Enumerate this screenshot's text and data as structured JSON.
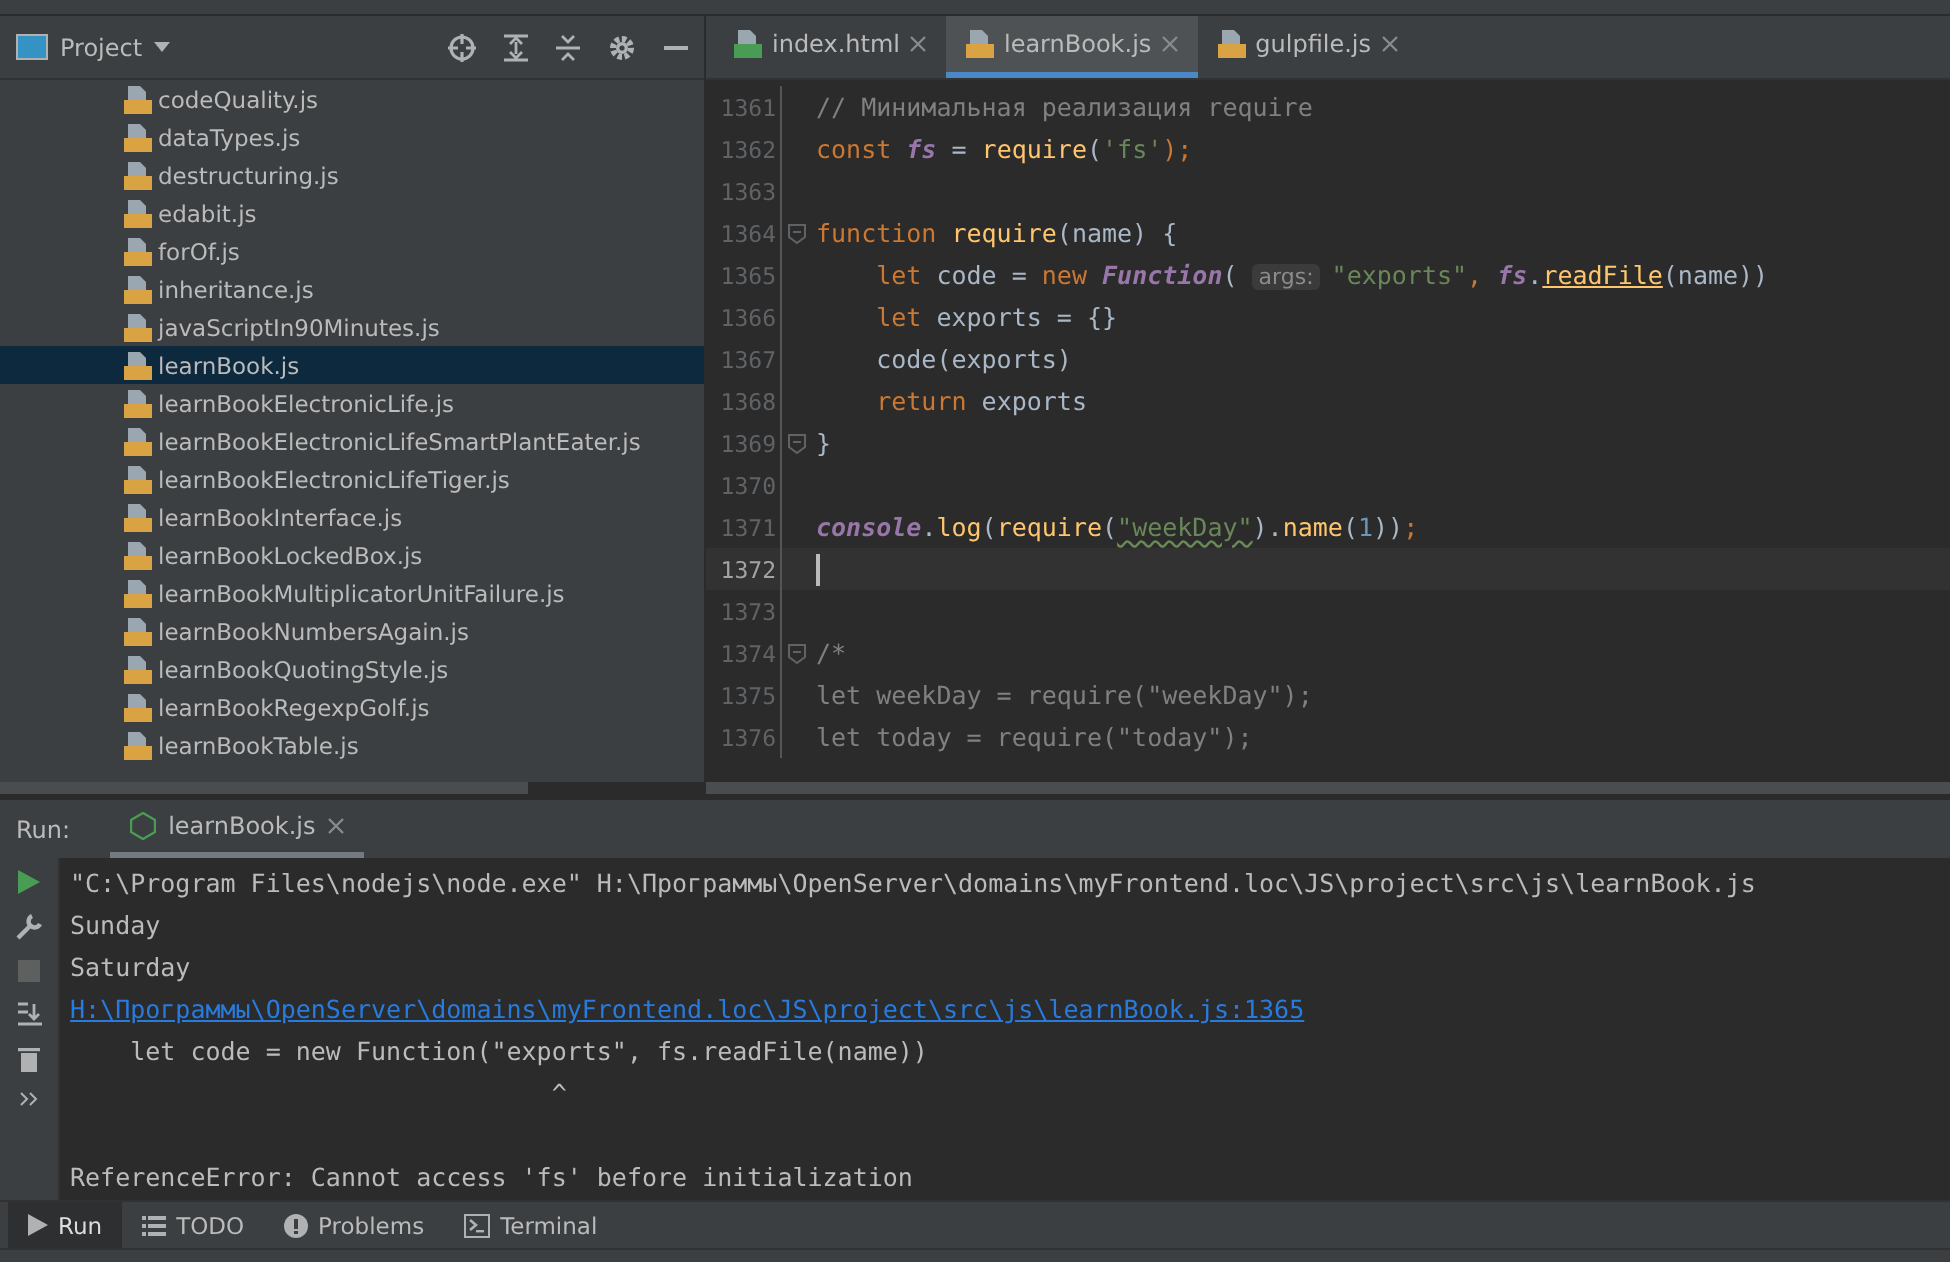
{
  "project_panel": {
    "title": "Project",
    "files": [
      {
        "name": "codeQuality.js",
        "selected": false
      },
      {
        "name": "dataTypes.js",
        "selected": false
      },
      {
        "name": "destructuring.js",
        "selected": false
      },
      {
        "name": "edabit.js",
        "selected": false
      },
      {
        "name": "forOf.js",
        "selected": false
      },
      {
        "name": "inheritance.js",
        "selected": false
      },
      {
        "name": "javaScriptIn90Minutes.js",
        "selected": false
      },
      {
        "name": "learnBook.js",
        "selected": true
      },
      {
        "name": "learnBookElectronicLife.js",
        "selected": false
      },
      {
        "name": "learnBookElectronicLifeSmartPlantEater.js",
        "selected": false
      },
      {
        "name": "learnBookElectronicLifeTiger.js",
        "selected": false
      },
      {
        "name": "learnBookInterface.js",
        "selected": false
      },
      {
        "name": "learnBookLockedBox.js",
        "selected": false
      },
      {
        "name": "learnBookMultiplicatorUnitFailure.js",
        "selected": false
      },
      {
        "name": "learnBookNumbersAgain.js",
        "selected": false
      },
      {
        "name": "learnBookQuotingStyle.js",
        "selected": false
      },
      {
        "name": "learnBookRegexpGolf.js",
        "selected": false
      },
      {
        "name": "learnBookTable.js",
        "selected": false
      }
    ]
  },
  "editor_tabs": [
    {
      "label": "index.html",
      "kind": "html",
      "selected": false
    },
    {
      "label": "learnBook.js",
      "kind": "js",
      "selected": true
    },
    {
      "label": "gulpfile.js",
      "kind": "js",
      "selected": false
    }
  ],
  "code_lines": [
    {
      "number": "1361",
      "current": false,
      "fold": false,
      "tokens": [
        {
          "t": "// Минимальная реализация require",
          "kind": "comment"
        }
      ]
    },
    {
      "number": "1362",
      "current": false,
      "fold": false,
      "tokens": [
        {
          "t": "const ",
          "kind": "keyword"
        },
        {
          "t": "fs",
          "kind": "global"
        },
        {
          "t": " = ",
          "kind": "plain"
        },
        {
          "t": "require",
          "kind": "fn"
        },
        {
          "t": "(",
          "kind": "plain"
        },
        {
          "t": "'fs'",
          "kind": "string"
        },
        {
          "t": ");",
          "kind": "keyword"
        }
      ]
    },
    {
      "number": "1363",
      "current": false,
      "fold": false
    },
    {
      "number": "1364",
      "current": false,
      "fold": true,
      "tokens": [
        {
          "t": "function ",
          "kind": "keyword"
        },
        {
          "t": "require",
          "kind": "fn"
        },
        {
          "t": "(name) {",
          "kind": "plain"
        }
      ]
    },
    {
      "number": "1365",
      "current": false,
      "fold": false,
      "tokens": [
        {
          "t": "    let ",
          "kind": "keyword"
        },
        {
          "t": "code = ",
          "kind": "plain"
        },
        {
          "t": "new ",
          "kind": "keyword"
        },
        {
          "t": "Function",
          "kind": "global"
        },
        {
          "t": "( ",
          "kind": "plain"
        },
        {
          "t": "args:",
          "kind": "hint"
        },
        {
          "t": "\"exports\"",
          "kind": "string"
        },
        {
          "t": ", ",
          "kind": "keyword"
        },
        {
          "t": "fs",
          "kind": "global"
        },
        {
          "t": ".",
          "kind": "plain"
        },
        {
          "t": "readFile",
          "kind": "fnlink"
        },
        {
          "t": "(name))",
          "kind": "plain"
        }
      ]
    },
    {
      "number": "1366",
      "current": false,
      "fold": false,
      "tokens": [
        {
          "t": "    let ",
          "kind": "keyword"
        },
        {
          "t": "exports = {}",
          "kind": "plain"
        }
      ]
    },
    {
      "number": "1367",
      "current": false,
      "fold": false,
      "tokens": [
        {
          "t": "    code(exports)",
          "kind": "plain"
        }
      ]
    },
    {
      "number": "1368",
      "current": false,
      "fold": false,
      "tokens": [
        {
          "t": "    return ",
          "kind": "keyword"
        },
        {
          "t": "exports",
          "kind": "plain"
        }
      ]
    },
    {
      "number": "1369",
      "current": false,
      "fold": true,
      "tokens": [
        {
          "t": "}",
          "kind": "plain"
        }
      ]
    },
    {
      "number": "1370",
      "current": false,
      "fold": false
    },
    {
      "number": "1371",
      "current": false,
      "fold": false,
      "tokens": [
        {
          "t": "console",
          "kind": "global"
        },
        {
          "t": ".",
          "kind": "plain"
        },
        {
          "t": "log",
          "kind": "fn"
        },
        {
          "t": "(",
          "kind": "plain"
        },
        {
          "t": "require",
          "kind": "fn"
        },
        {
          "t": "(",
          "kind": "plain"
        },
        {
          "t": "\"weekDay\"",
          "kind": "typo"
        },
        {
          "t": ").",
          "kind": "plain"
        },
        {
          "t": "name",
          "kind": "fn"
        },
        {
          "t": "(",
          "kind": "plain"
        },
        {
          "t": "1",
          "kind": "number"
        },
        {
          "t": "))",
          "kind": "plain"
        },
        {
          "t": ";",
          "kind": "keyword"
        }
      ]
    },
    {
      "number": "1372",
      "current": true,
      "fold": false
    },
    {
      "number": "1373",
      "current": false,
      "fold": false
    },
    {
      "number": "1374",
      "current": false,
      "fold": true,
      "tokens": [
        {
          "t": "/*",
          "kind": "comment"
        }
      ]
    },
    {
      "number": "1375",
      "current": false,
      "fold": false,
      "tokens": [
        {
          "t": "let weekDay = require(\"weekDay\");",
          "kind": "comment"
        }
      ]
    },
    {
      "number": "1376",
      "current": false,
      "fold": false,
      "tokens": [
        {
          "t": "let today = require(\"today\");",
          "kind": "comment"
        }
      ]
    }
  ],
  "run_panel": {
    "label": "Run:",
    "tab": "learnBook.js",
    "output": [
      {
        "text": "\"C:\\Program Files\\nodejs\\node.exe\" H:\\Программы\\OpenServer\\domains\\myFrontend.loc\\JS\\project\\src\\js\\learnBook.js",
        "kind": "plain"
      },
      {
        "text": "Sunday",
        "kind": "plain"
      },
      {
        "text": "Saturday",
        "kind": "plain"
      },
      {
        "text": "H:\\Программы\\OpenServer\\domains\\myFrontend.loc\\JS\\project\\src\\js\\learnBook.js:1365",
        "kind": "link"
      },
      {
        "text": "    let code = new Function(\"exports\", fs.readFile(name))",
        "kind": "plain"
      },
      {
        "text": "                                ^",
        "kind": "plain"
      },
      {
        "kind": "blank"
      },
      {
        "text": "ReferenceError: Cannot access 'fs' before initialization",
        "kind": "plain"
      }
    ]
  },
  "tool_tabs": [
    {
      "label": "Run",
      "kind": "run",
      "selected": true
    },
    {
      "label": "TODO",
      "kind": "todo",
      "selected": false
    },
    {
      "label": "Problems",
      "kind": "problems",
      "selected": false
    },
    {
      "label": "Terminal",
      "kind": "terminal",
      "selected": false
    }
  ]
}
